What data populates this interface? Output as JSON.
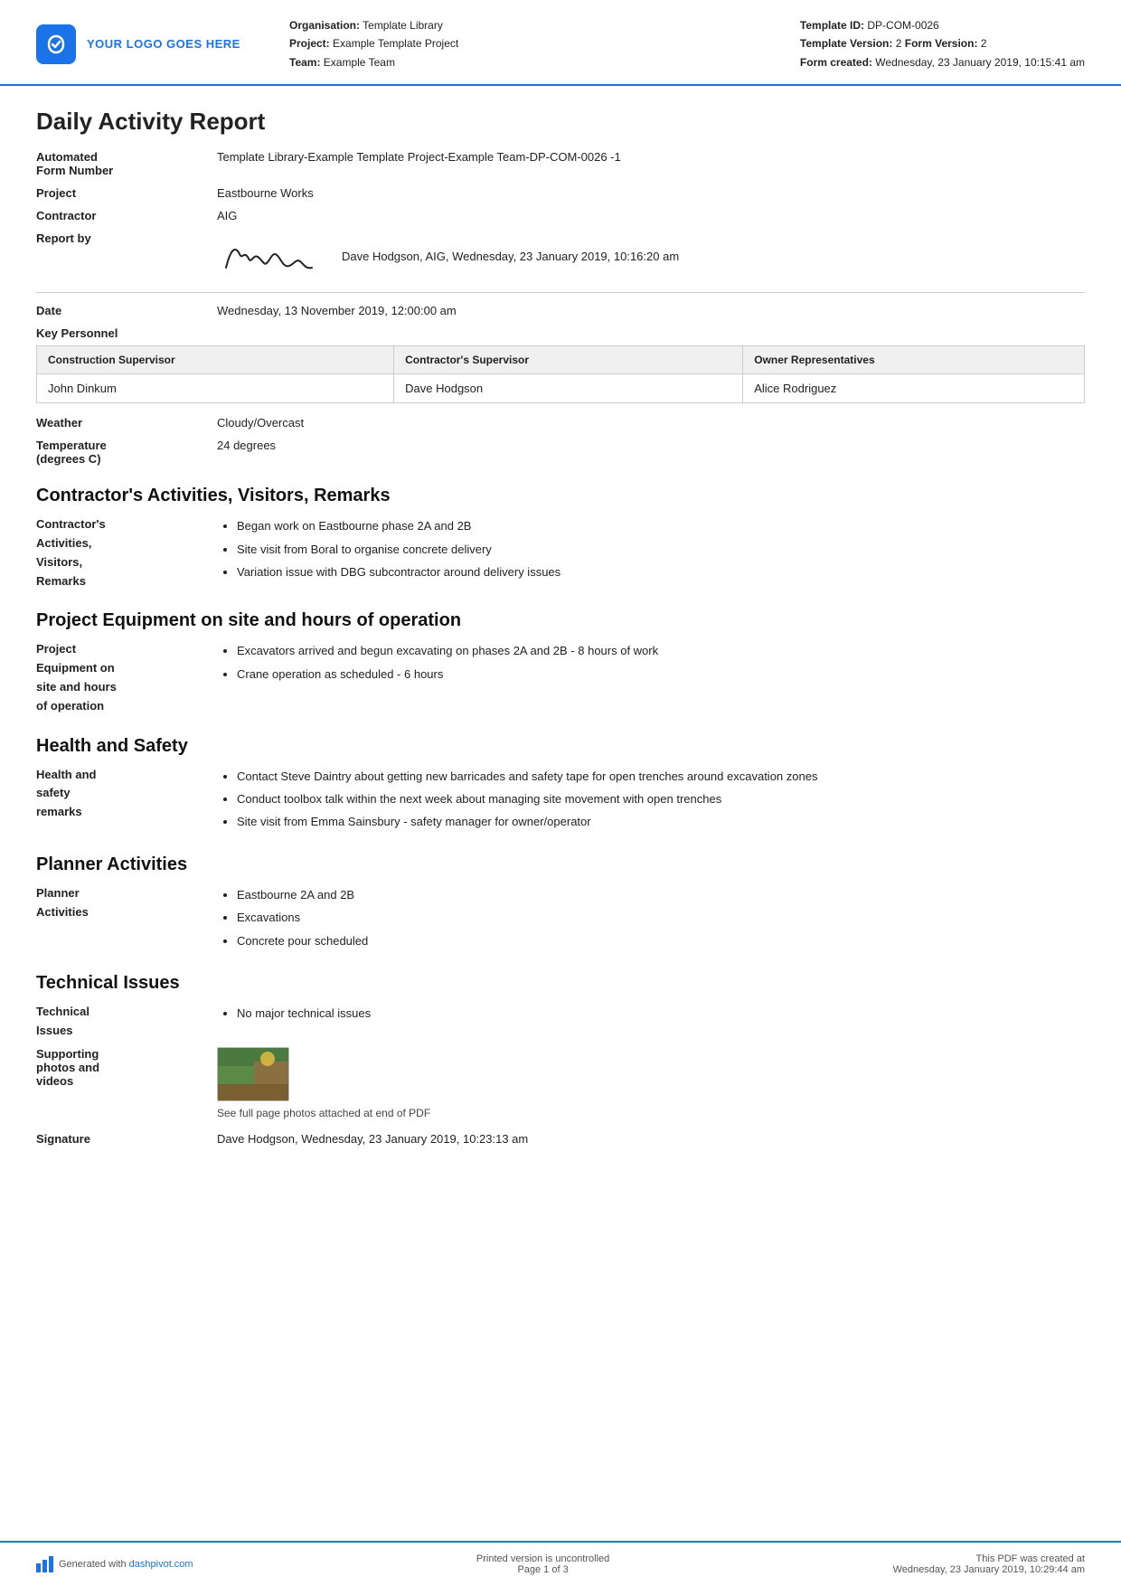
{
  "header": {
    "logo_text": "YOUR LOGO GOES HERE",
    "org_label": "Organisation:",
    "org_value": "Template Library",
    "project_label": "Project:",
    "project_value": "Example Template Project",
    "team_label": "Team:",
    "team_value": "Example Team",
    "template_id_label": "Template ID:",
    "template_id_value": "DP-COM-0026",
    "template_version_label": "Template Version:",
    "template_version_value": "2",
    "form_version_label": "Form Version:",
    "form_version_value": "2",
    "form_created_label": "Form created:",
    "form_created_value": "Wednesday, 23 January 2019, 10:15:41 am"
  },
  "report": {
    "title": "Daily Activity Report",
    "automated_label": "Automated\nForm Number",
    "automated_value": "Template Library-Example Template Project-Example Team-DP-COM-0026   -1",
    "project_label": "Project",
    "project_value": "Eastbourne Works",
    "contractor_label": "Contractor",
    "contractor_value": "AIG",
    "report_by_label": "Report by",
    "report_by_value": "Dave Hodgson, AIG, Wednesday, 23 January 2019, 10:16:20 am",
    "date_label": "Date",
    "date_value": "Wednesday, 13 November 2019, 12:00:00 am"
  },
  "key_personnel": {
    "label": "Key Personnel",
    "headers": [
      "Construction Supervisor",
      "Contractor's Supervisor",
      "Owner Representatives"
    ],
    "rows": [
      [
        "John Dinkum",
        "Dave Hodgson",
        "Alice Rodriguez"
      ]
    ]
  },
  "weather": {
    "label": "Weather",
    "value": "Cloudy/Overcast"
  },
  "temperature": {
    "label": "Temperature\n(degrees C)",
    "value": "24 degrees"
  },
  "contractors_activities": {
    "heading": "Contractor's Activities, Visitors, Remarks",
    "label": "Contractor's\nActivities,\nVisitors,\nRemarks",
    "items": [
      "Began work on Eastbourne phase 2A and 2B",
      "Site visit from Boral to organise concrete delivery",
      "Variation issue with DBG subcontractor around delivery issues"
    ]
  },
  "project_equipment": {
    "heading": "Project Equipment on site and hours of operation",
    "label": "Project\nEquipment on\nsite and hours\nof operation",
    "items": [
      "Excavators arrived and begun excavating on phases 2A and 2B - 8 hours of work",
      "Crane operation as scheduled - 6 hours"
    ]
  },
  "health_safety": {
    "heading": "Health and Safety",
    "label": "Health and\nsafety\nremarks",
    "items": [
      "Contact Steve Daintry about getting new barricades and safety tape for open trenches around excavation zones",
      "Conduct toolbox talk within the next week about managing site movement with open trenches",
      "Site visit from Emma Sainsbury - safety manager for owner/operator"
    ]
  },
  "planner_activities": {
    "heading": "Planner Activities",
    "label": "Planner\nActivities",
    "items": [
      "Eastbourne 2A and 2B",
      "Excavations",
      "Concrete pour scheduled"
    ]
  },
  "technical_issues": {
    "heading": "Technical Issues",
    "label": "Technical\nIssues",
    "items": [
      "No major technical issues"
    ],
    "photos_label": "Supporting\nphotos and\nvideos",
    "photo_caption": "See full page photos attached at end of PDF"
  },
  "signature": {
    "label": "Signature",
    "value": "Dave Hodgson, Wednesday, 23 January 2019, 10:23:13 am"
  },
  "footer": {
    "generated_prefix": "Generated with ",
    "generated_link": "dashpivot.com",
    "page_info": "Printed version is uncontrolled\nPage 1 of 3",
    "pdf_created": "This PDF was created at\nWednesday, 23 January 2019, 10:29:44 am"
  }
}
